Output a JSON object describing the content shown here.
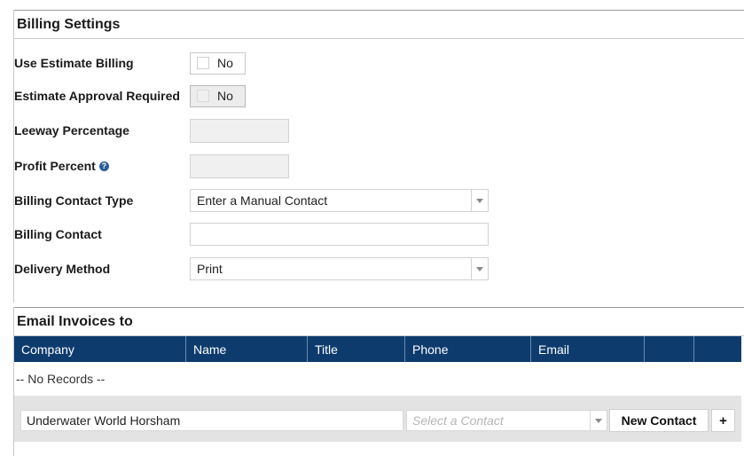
{
  "billing": {
    "title": "Billing Settings",
    "fields": {
      "use_estimate": {
        "label": "Use Estimate Billing",
        "value": "No"
      },
      "approval": {
        "label": "Estimate Approval Required",
        "value": "No"
      },
      "leeway": {
        "label": "Leeway Percentage",
        "value": ""
      },
      "profit": {
        "label": "Profit Percent",
        "help_icon": "?",
        "value": ""
      },
      "contact_type": {
        "label": "Billing Contact Type",
        "value": "Enter a Manual Contact"
      },
      "contact": {
        "label": "Billing Contact",
        "value": ""
      },
      "delivery": {
        "label": "Delivery Method",
        "value": "Print"
      }
    }
  },
  "email": {
    "title": "Email Invoices to",
    "columns": [
      "Company",
      "Name",
      "Title",
      "Phone",
      "Email",
      "",
      ""
    ],
    "empty_text": "-- No Records --",
    "footer": {
      "company_value": "Underwater World Horsham",
      "contact_placeholder": "Select a Contact",
      "new_contact_label": "New Contact",
      "add_label": "+"
    }
  },
  "colors": {
    "grid_header": "#0d3b6e",
    "help_icon": "#2a5d9a"
  },
  "icons": [
    "help-icon",
    "chevron-down-icon"
  ]
}
